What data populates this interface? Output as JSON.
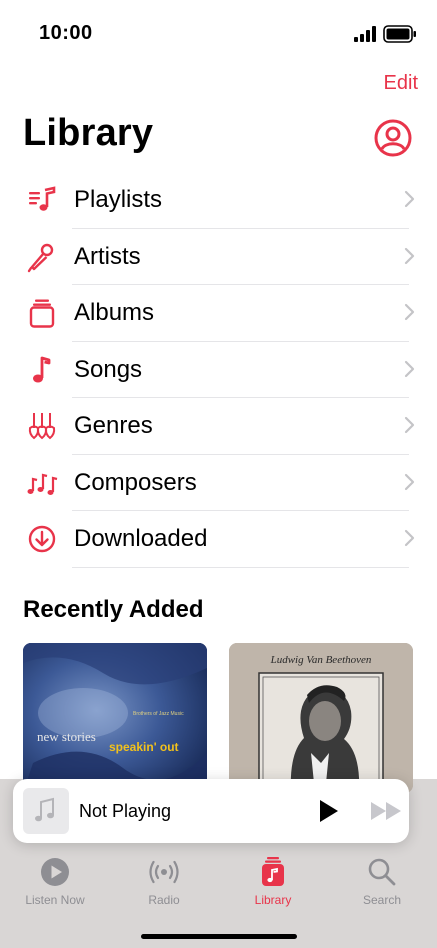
{
  "status_bar": {
    "time": "10:00"
  },
  "header": {
    "edit_label": "Edit",
    "title": "Library"
  },
  "library_items": [
    {
      "label": "Playlists",
      "icon": "playlists-icon"
    },
    {
      "label": "Artists",
      "icon": "microphone-icon"
    },
    {
      "label": "Albums",
      "icon": "albums-icon"
    },
    {
      "label": "Songs",
      "icon": "music-note-icon"
    },
    {
      "label": "Genres",
      "icon": "guitars-icon"
    },
    {
      "label": "Composers",
      "icon": "composers-icon"
    },
    {
      "label": "Downloaded",
      "icon": "download-icon"
    }
  ],
  "recently_added": {
    "title": "Recently Added",
    "albums": [
      {
        "cover_text_1": "new stories",
        "cover_text_2": "speakin' out",
        "cover_text_3": "Brothers of Jazz Music"
      },
      {
        "cover_text_1": "Ludwig Van Beethoven"
      }
    ]
  },
  "mini_player": {
    "title": "Not Playing"
  },
  "tab_bar": {
    "tabs": [
      {
        "label": "Listen Now",
        "icon": "play-circle-icon",
        "active": false
      },
      {
        "label": "Radio",
        "icon": "radio-waves-icon",
        "active": false
      },
      {
        "label": "Library",
        "icon": "library-icon",
        "active": true
      },
      {
        "label": "Search",
        "icon": "search-icon",
        "active": false
      }
    ]
  },
  "colors": {
    "accent": "#e8344a",
    "tab_inactive": "#8e8e93",
    "tabbar_bg": "#d9d6d5"
  }
}
